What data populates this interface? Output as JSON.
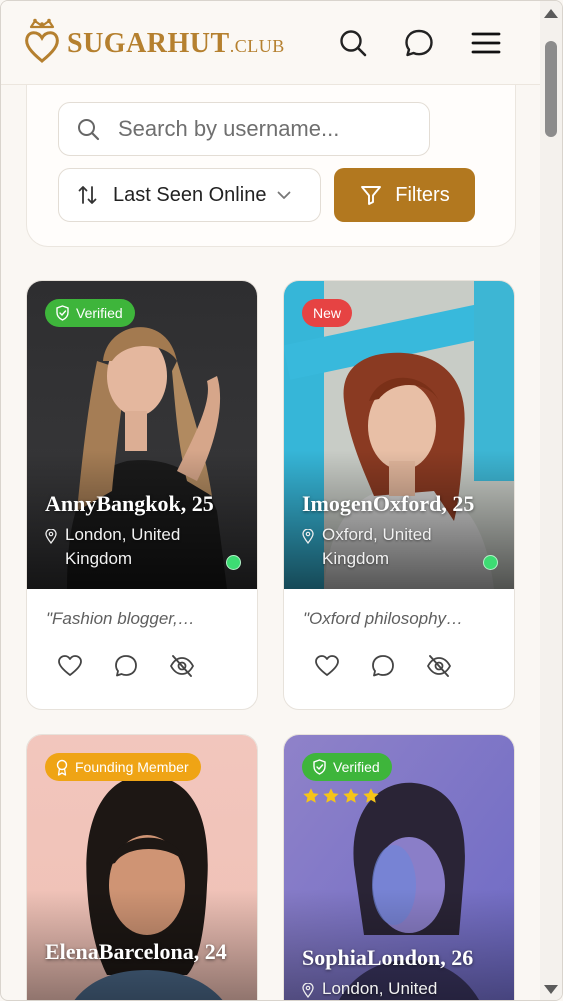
{
  "app": {
    "logo_text": "SUGARHUT",
    "logo_suffix": ".CLUB",
    "accent_color": "#b2781f"
  },
  "header": {
    "icons": [
      "search-icon",
      "chat-icon",
      "menu-icon"
    ]
  },
  "search": {
    "placeholder": "Search by username...",
    "value": ""
  },
  "sort": {
    "selected": "Last Seen Online"
  },
  "filters": {
    "label": "Filters"
  },
  "profiles": [
    {
      "badge": "Verified",
      "badge_color": "#3eb53b",
      "name": "AnnyBangkok, 25",
      "location": "London, United Kingdom",
      "bio": "\"Fashion blogger,…",
      "online": true
    },
    {
      "badge": "New",
      "badge_color": "#e64343",
      "name": "ImogenOxford, 25",
      "location": "Oxford, United Kingdom",
      "bio": "\"Oxford philosophy…",
      "online": true
    },
    {
      "badge": "Founding Member",
      "badge_color": "#efa415",
      "name": "ElenaBarcelona, 24",
      "location": "",
      "bio": "",
      "online": false
    },
    {
      "badge": "Verified",
      "badge_color": "#3eb53b",
      "rating_stars": 4,
      "name": "SophiaLondon, 26",
      "location": "London, United",
      "bio": "",
      "online": false
    }
  ]
}
